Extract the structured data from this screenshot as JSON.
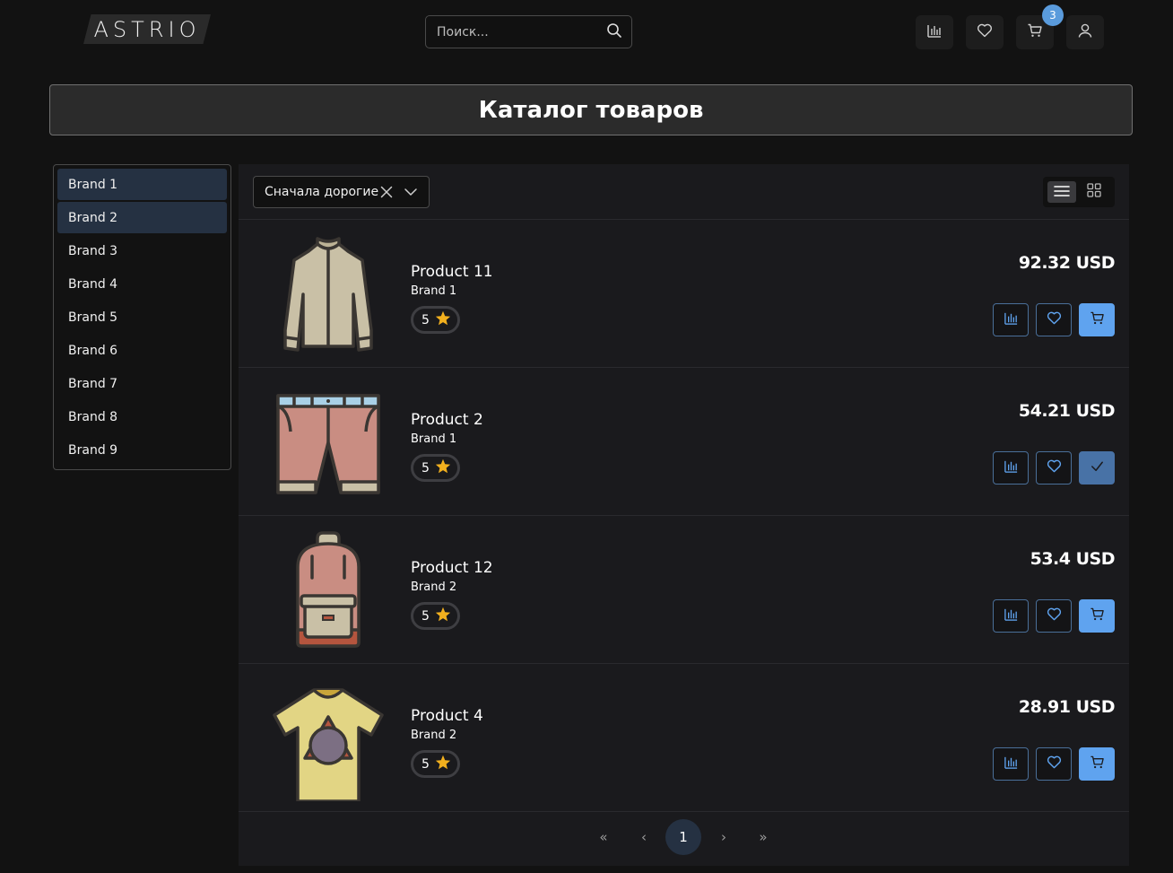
{
  "header": {
    "logo_text": "ASTRIO",
    "search_placeholder": "Поиск...",
    "cart_count": "3",
    "icons": [
      "compare-icon",
      "heart-icon",
      "cart-icon",
      "user-icon"
    ]
  },
  "page_title": "Каталог товаров",
  "sidebar": {
    "brands": [
      {
        "label": "Brand 1",
        "active": true
      },
      {
        "label": "Brand 2",
        "active": true
      },
      {
        "label": "Brand 3",
        "active": false
      },
      {
        "label": "Brand 4",
        "active": false
      },
      {
        "label": "Brand 5",
        "active": false
      },
      {
        "label": "Brand 6",
        "active": false
      },
      {
        "label": "Brand 7",
        "active": false
      },
      {
        "label": "Brand 8",
        "active": false
      },
      {
        "label": "Brand 9",
        "active": false
      }
    ]
  },
  "toolbar": {
    "sort_value": "Сначала дорогие",
    "view_mode": "list"
  },
  "products": [
    {
      "name": "Product 11",
      "brand": "Brand 1",
      "rating": "5",
      "price": "92.32 USD",
      "image": "shirt",
      "in_cart": false
    },
    {
      "name": "Product 2",
      "brand": "Brand 1",
      "rating": "5",
      "price": "54.21 USD",
      "image": "shorts",
      "in_cart": true
    },
    {
      "name": "Product 12",
      "brand": "Brand 2",
      "rating": "5",
      "price": "53.4 USD",
      "image": "backpack",
      "in_cart": false
    },
    {
      "name": "Product 4",
      "brand": "Brand 2",
      "rating": "5",
      "price": "28.91 USD",
      "image": "tshirt",
      "in_cart": false
    }
  ],
  "pagination": {
    "first": "«",
    "prev": "‹",
    "current": "1",
    "next": "›",
    "last": "»"
  },
  "colors": {
    "background": "#121212",
    "panel": "#1a1a1d",
    "accent": "#5fa3ef",
    "accent_added": "#4872a6",
    "active_item": "#253142",
    "star": "#f2b01e"
  }
}
